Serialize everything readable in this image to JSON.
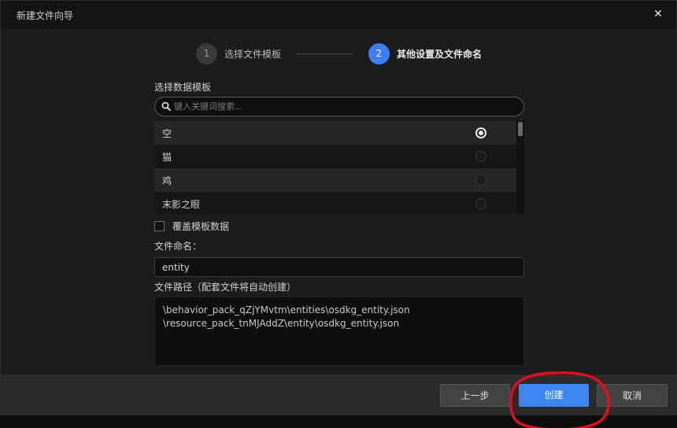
{
  "window": {
    "title": "新建文件向导"
  },
  "steps": [
    {
      "number": "1",
      "label": "选择文件模板",
      "active": false
    },
    {
      "number": "2",
      "label": "其他设置及文件命名",
      "active": true
    }
  ],
  "template_section": {
    "label": "选择数据模板",
    "search_placeholder": "键入关键词搜索...",
    "items": [
      {
        "label": "空",
        "selected": true
      },
      {
        "label": "猫",
        "selected": false
      },
      {
        "label": "鸡",
        "selected": false
      },
      {
        "label": "末影之眼",
        "selected": false
      }
    ]
  },
  "override_checkbox": {
    "label": "覆盖模板数据",
    "checked": false
  },
  "file_name": {
    "label": "文件命名：",
    "value": "entity"
  },
  "file_path": {
    "label": "文件路径（配套文件将自动创建）",
    "lines": [
      "\\behavior_pack_qZjYMvtm\\entities\\osdkg_entity.json",
      "\\resource_pack_tnMJAddZ\\entity\\osdkg_entity.json"
    ]
  },
  "buttons": {
    "prev": "上一步",
    "create": "创建",
    "cancel": "取消"
  },
  "colors": {
    "accent": "#3f86f2",
    "annotation": "#e0101a"
  }
}
